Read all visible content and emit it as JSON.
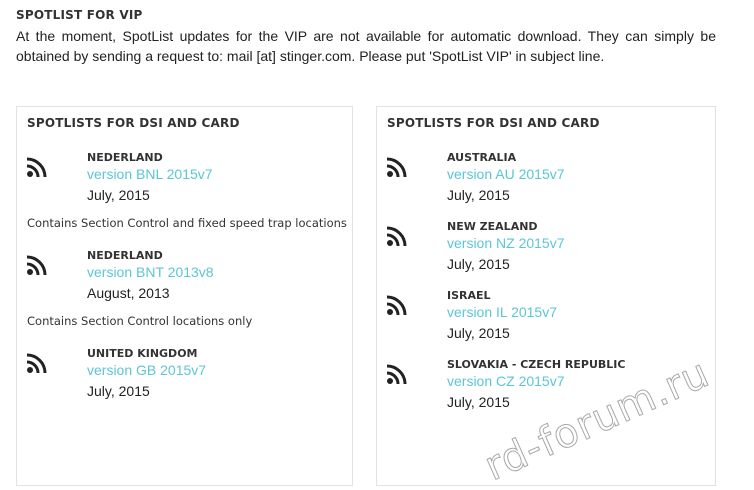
{
  "vip": {
    "title": "SPOTLIST FOR VIP",
    "text": "At the moment, SpotList updates for the VIP are not available for automatic download. They can simply be obtained by sending a request to: mail [at] stinger.com. Please put 'SpotList VIP' in subject line."
  },
  "left_panel": {
    "title": "SPOTLISTS FOR DSI AND CARD",
    "entries": [
      {
        "country": "NEDERLAND",
        "version": "version BNL 2015v7",
        "date": "July, 2015",
        "note": "Contains Section Control and fixed speed trap locations"
      },
      {
        "country": "NEDERLAND",
        "version": "version BNT 2013v8",
        "date": "August, 2013",
        "note": "Contains Section Control locations only"
      },
      {
        "country": "UNITED KINGDOM",
        "version": "version GB 2015v7",
        "date": "July, 2015"
      }
    ]
  },
  "right_panel": {
    "title": "SPOTLISTS FOR DSI AND CARD",
    "entries": [
      {
        "country": "AUSTRALIA",
        "version": "version AU 2015v7",
        "date": "July, 2015"
      },
      {
        "country": "NEW ZEALAND",
        "version": "version NZ 2015v7",
        "date": "July, 2015"
      },
      {
        "country": "ISRAEL",
        "version": "version IL 2015v7",
        "date": "July, 2015"
      },
      {
        "country": "SLOVAKIA - CZECH REPUBLIC",
        "version": "version CZ 2015v7",
        "date": "July, 2015"
      }
    ]
  },
  "icon": "rss-feed-icon",
  "colors": {
    "link": "#5bc6d6",
    "text": "#222222",
    "border": "#e2e2e2"
  },
  "watermark": "rd-forum.ru"
}
